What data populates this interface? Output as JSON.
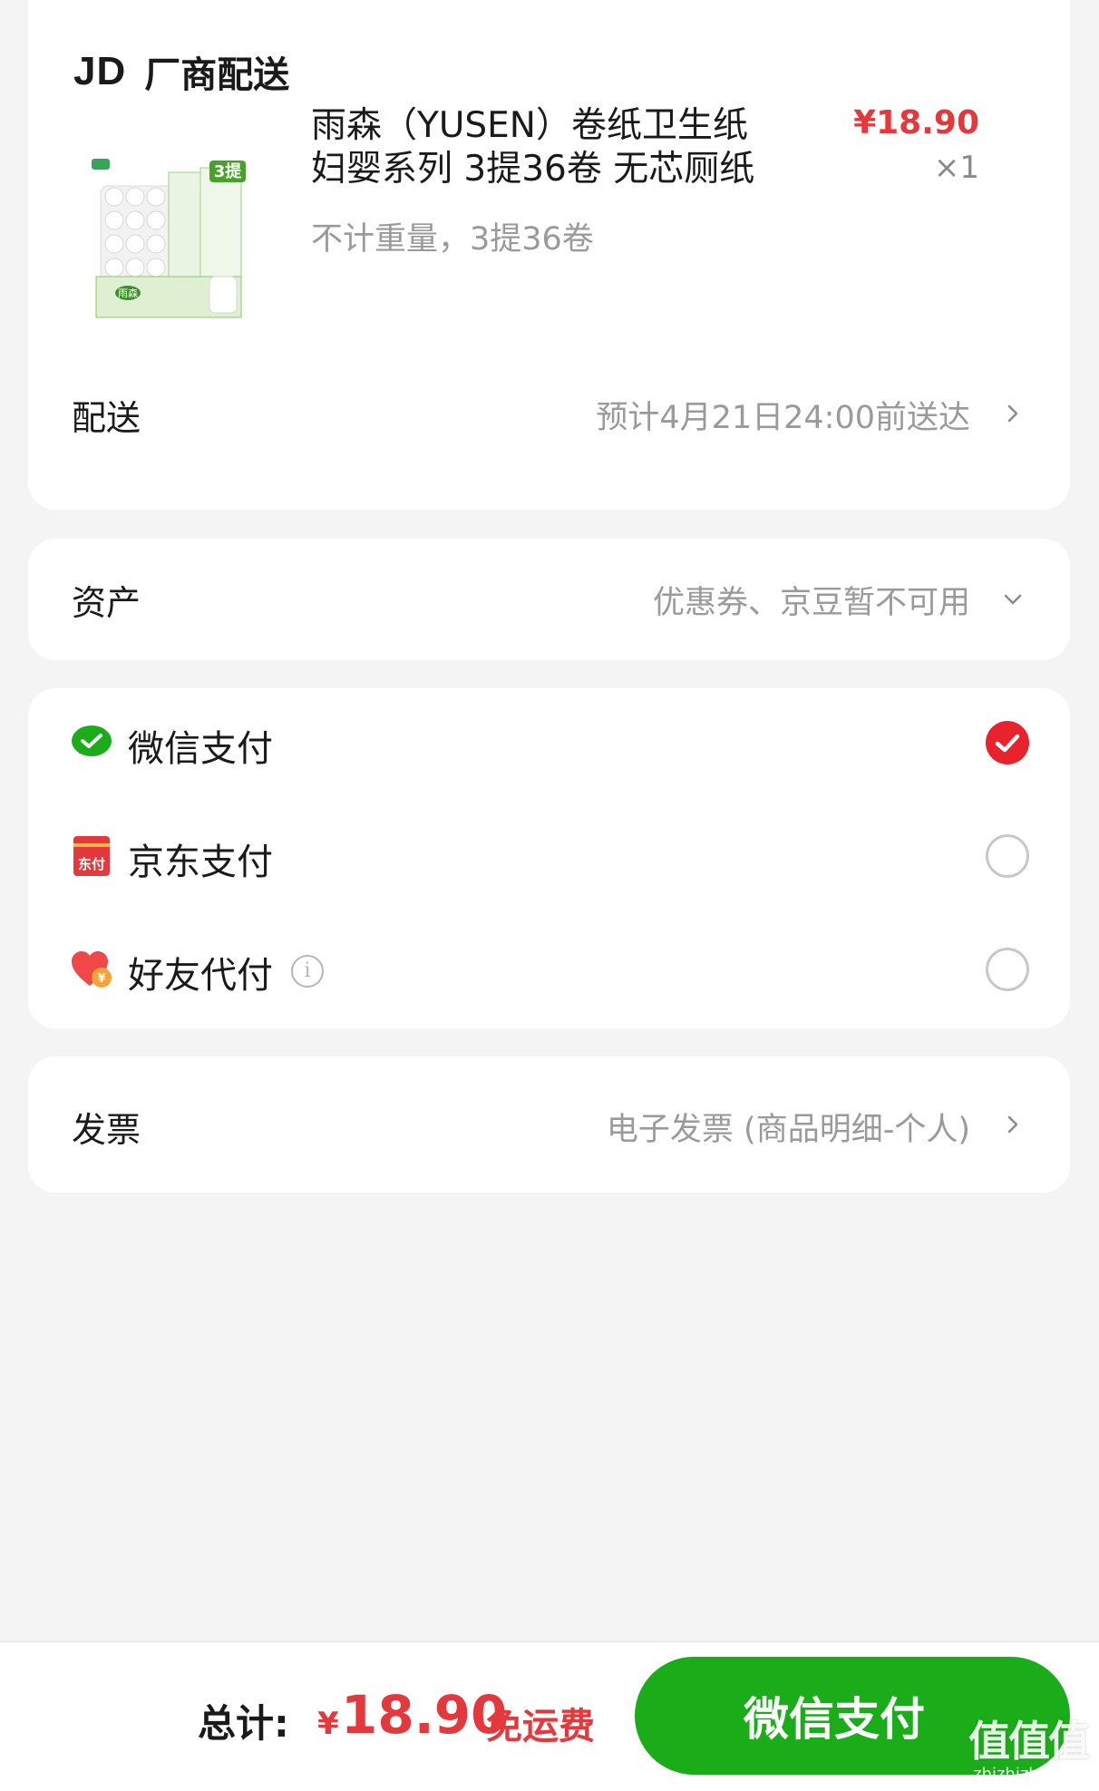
{
  "order": {
    "store_logo": "JD",
    "store_name": "厂商配送",
    "product": {
      "title": "雨森（YUSEN）卷纸卫生纸妇婴系列 3提36卷 无芯厕纸",
      "spec": "不计重量，3提36卷",
      "price": "¥18.90",
      "quantity": "×1",
      "image_badge": "3提",
      "image_brand": "雨森"
    },
    "delivery": {
      "label": "配送",
      "value": "预计4月21日24:00前送达"
    }
  },
  "assets": {
    "label": "资产",
    "value": "优惠券、京豆暂不可用"
  },
  "payment": {
    "methods": [
      {
        "label": "微信支付",
        "selected": true
      },
      {
        "label": "京东支付",
        "selected": false,
        "icon_text": "东付"
      },
      {
        "label": "好友代付",
        "selected": false,
        "icon_text": "¥"
      }
    ]
  },
  "invoice": {
    "label": "发票",
    "value": "电子发票 (商品明细-个人)"
  },
  "footer": {
    "total_label": "总计:",
    "currency": "¥",
    "total_amount": "18.90",
    "shipping_note": "免运费",
    "pay_button": "微信支付"
  },
  "watermark": {
    "main": "值值值",
    "sub": "zhizhizhi.com"
  },
  "colors": {
    "accent_red": "#e4393c",
    "wechat_green": "#1aad19",
    "background": "#f4f4f4"
  }
}
